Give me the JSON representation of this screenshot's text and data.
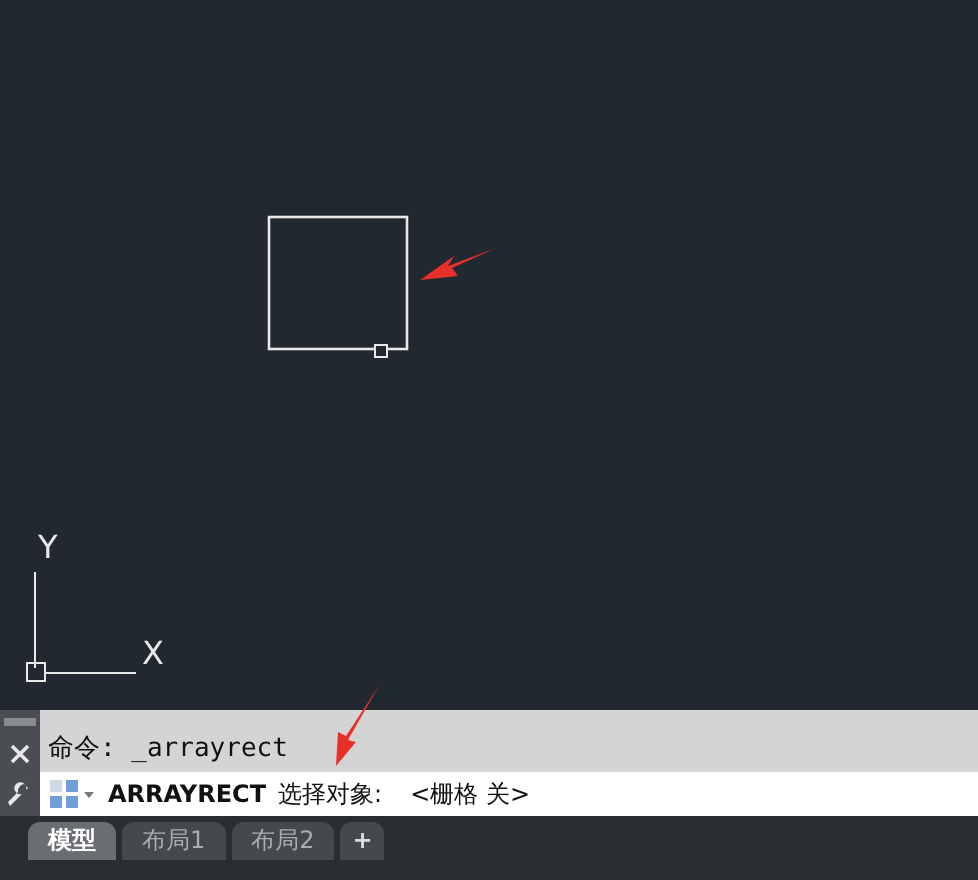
{
  "canvas": {
    "axis_y": "Y",
    "axis_x": "X"
  },
  "command_line": {
    "history": "命令: _arrayrect",
    "command": "ARRAYRECT",
    "prompt": "选择对象:",
    "option": "<栅格 关>"
  },
  "tabs": [
    {
      "label": "模型",
      "selected": true
    },
    {
      "label": "布局1",
      "selected": false
    },
    {
      "label": "布局2",
      "selected": false
    }
  ],
  "add_tab": "+"
}
